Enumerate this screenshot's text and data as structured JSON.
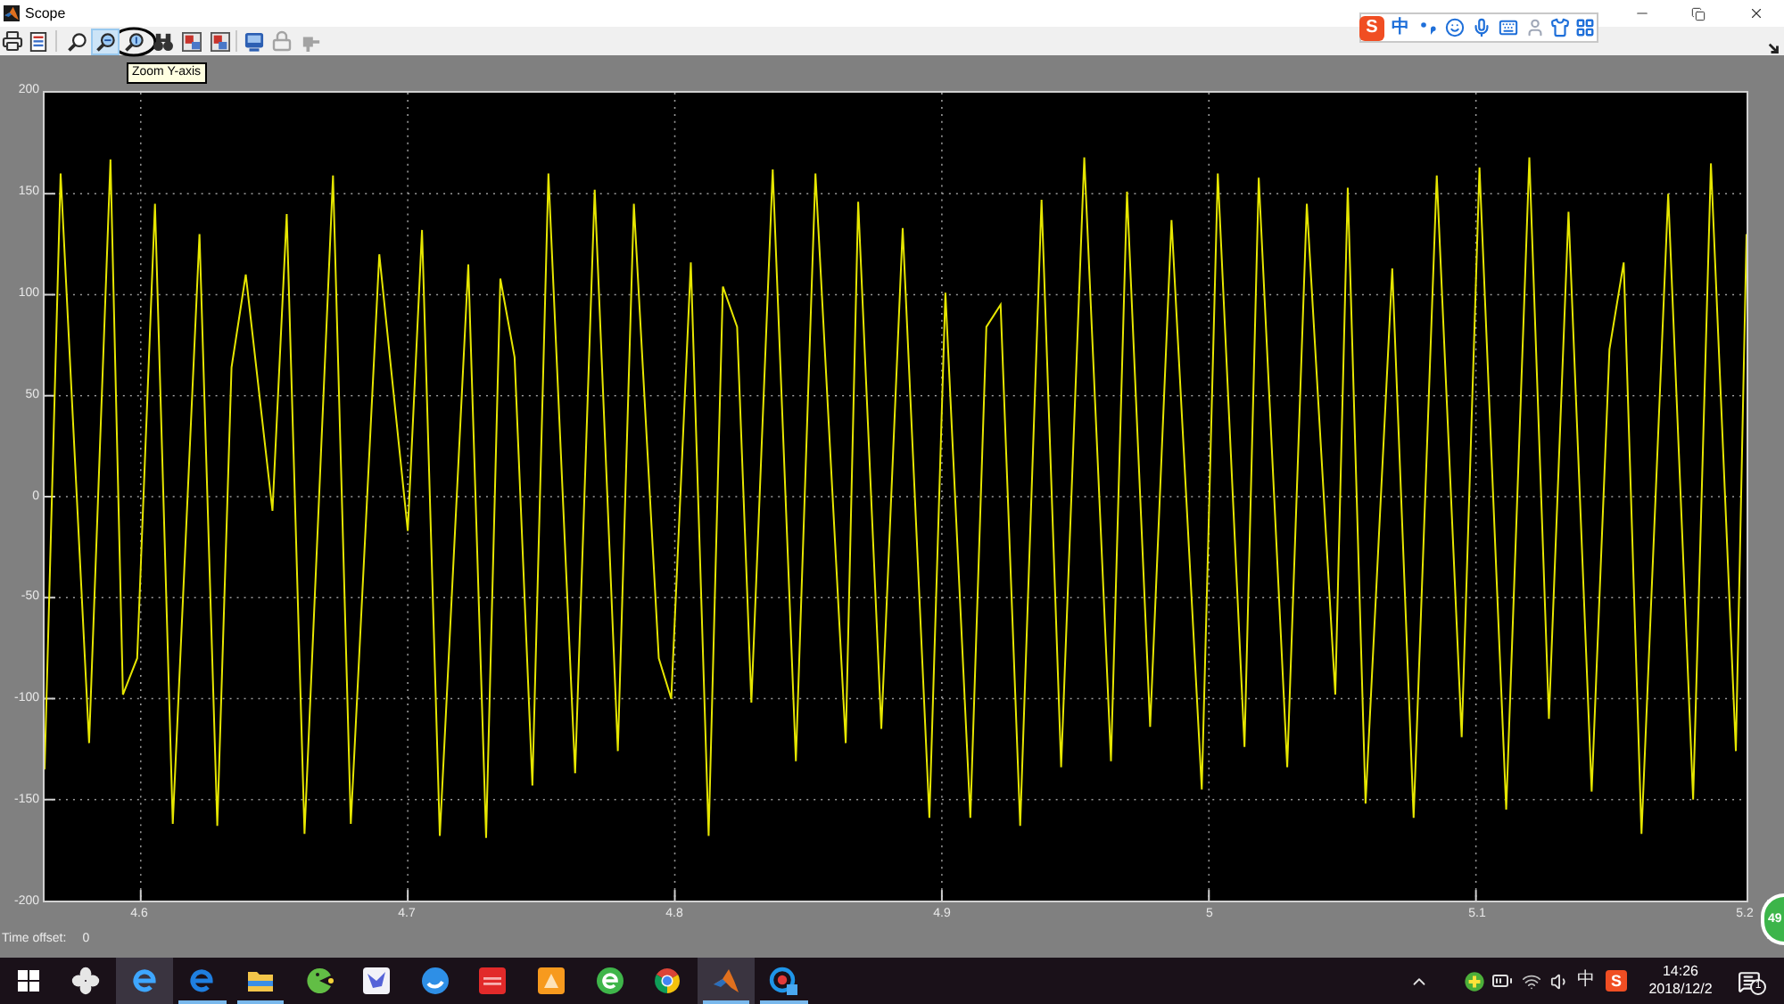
{
  "window": {
    "title": "Scope"
  },
  "toolbar": {
    "groups": [
      {
        "buttons": [
          {
            "kind": "print",
            "selected": false,
            "disabled": false,
            "circled": false
          },
          {
            "kind": "parameters",
            "selected": false,
            "disabled": false,
            "circled": false
          }
        ]
      },
      {
        "buttons": [
          {
            "kind": "zoom",
            "selected": false,
            "disabled": false,
            "circled": false
          },
          {
            "kind": "zoom-x",
            "selected": true,
            "disabled": false,
            "circled": false
          },
          {
            "kind": "zoom-y",
            "selected": false,
            "disabled": false,
            "circled": true,
            "tooltip": "Zoom Y-axis"
          },
          {
            "kind": "autoscale",
            "selected": false,
            "disabled": false,
            "circled": false
          },
          {
            "kind": "save-axes",
            "selected": false,
            "disabled": false,
            "circled": false
          },
          {
            "kind": "restore-axes",
            "selected": false,
            "disabled": false,
            "circled": false
          }
        ]
      },
      {
        "buttons": [
          {
            "kind": "floating",
            "selected": false,
            "disabled": false,
            "circled": false
          },
          {
            "kind": "lock",
            "selected": false,
            "disabled": true,
            "circled": false
          },
          {
            "kind": "signal-select",
            "selected": false,
            "disabled": true,
            "circled": false
          }
        ]
      }
    ]
  },
  "input_method_bar": {
    "logo": "S",
    "mode": "中"
  },
  "plot": {
    "y_tick_labels": [
      "200",
      "150",
      "100",
      "50",
      "0",
      "-50",
      "-100",
      "-150",
      "-200"
    ],
    "x_tick_labels": [
      "4.6",
      "4.7",
      "4.8",
      "4.9",
      "5",
      "5.1",
      "5.2"
    ]
  },
  "time_offset": {
    "label": "Time offset:",
    "value": "0"
  },
  "floating_ball": {
    "text": "49"
  },
  "taskbar": {
    "apps": [
      {
        "kind": "fan",
        "highlighted": false,
        "running": false
      },
      {
        "kind": "ie",
        "highlighted": true,
        "running": false
      },
      {
        "kind": "edge",
        "highlighted": false,
        "running": true
      },
      {
        "kind": "explorer",
        "highlighted": false,
        "running": true
      },
      {
        "kind": "pacman",
        "highlighted": false,
        "running": false
      },
      {
        "kind": "bird",
        "highlighted": false,
        "running": false
      },
      {
        "kind": "bubble",
        "highlighted": false,
        "running": false
      },
      {
        "kind": "youdao",
        "highlighted": false,
        "running": false
      },
      {
        "kind": "orange-app",
        "highlighted": false,
        "running": false
      },
      {
        "kind": "green-e",
        "highlighted": false,
        "running": false
      },
      {
        "kind": "chrome",
        "highlighted": false,
        "running": false
      },
      {
        "kind": "matlab",
        "highlighted": true,
        "running": true
      },
      {
        "kind": "player",
        "highlighted": false,
        "running": true
      }
    ],
    "tray": {
      "input_mode": "中",
      "ime_logo": "S",
      "time": "14:26",
      "date": "2018/12/2",
      "notification_count": "1"
    }
  }
}
